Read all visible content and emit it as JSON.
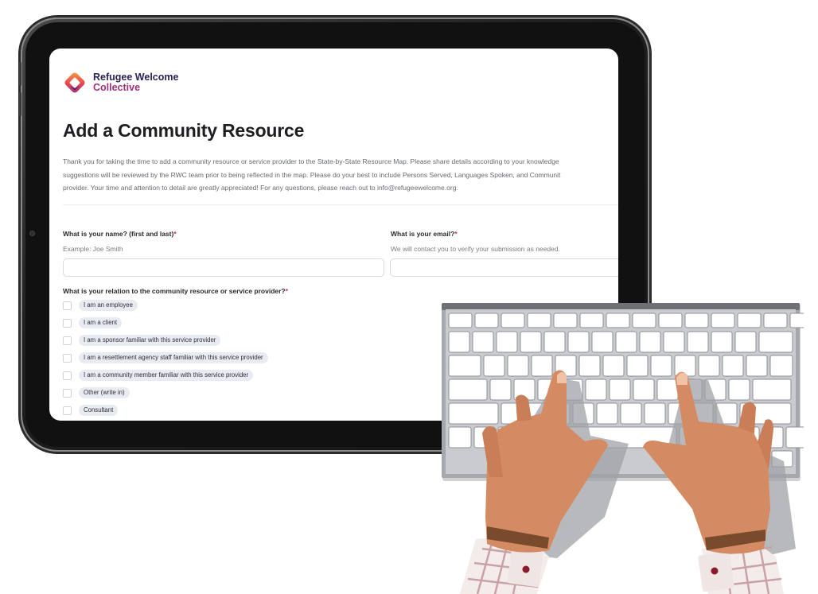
{
  "brand": {
    "line1": "Refugee Welcome",
    "line2": "Collective"
  },
  "form": {
    "title": "Add a Community Resource",
    "intro_lines": [
      "Thank you for taking the time to add a community resource or service provider to the State-by-State Resource Map. Please share details according to your knowledge",
      "suggestions will be reviewed by the RWC team prior to being reflected in the map. Please do your best to include Persons Served, Languages Spoken, and Communit",
      "provider. Your time and attention to detail are greatly appreciated! For any questions, please reach out to info@refugeewelcome.org."
    ],
    "name_question": {
      "label": "What is your name? (first and last)",
      "required_mark": "*",
      "hint": "Example: Joe Smith",
      "value": ""
    },
    "email_question": {
      "label": "What is your email?",
      "required_mark": "*",
      "hint": "We will contact you to verify your submission as needed.",
      "value": ""
    },
    "relation_question": {
      "label": "What is your relation to the community resource or service provider?",
      "required_mark": "*",
      "options": [
        "I am an employee",
        "I am a client",
        "I am a sponsor familiar with this service provider",
        "I am a resettlement agency staff familiar with this service provider",
        "I am a community member familiar with this service provider",
        "Other (write in)",
        "Consultant"
      ]
    }
  },
  "colors": {
    "brand_navy": "#2b2256",
    "brand_magenta": "#a0307a",
    "required": "#d22c3c",
    "chip_bg": "#e9ebf3",
    "skin": "#d48a62",
    "cuff_button": "#8a1a2c"
  },
  "icons": [
    "refugee-welcome-logo-icon",
    "keyboard-illustration",
    "typing-hands-illustration"
  ]
}
